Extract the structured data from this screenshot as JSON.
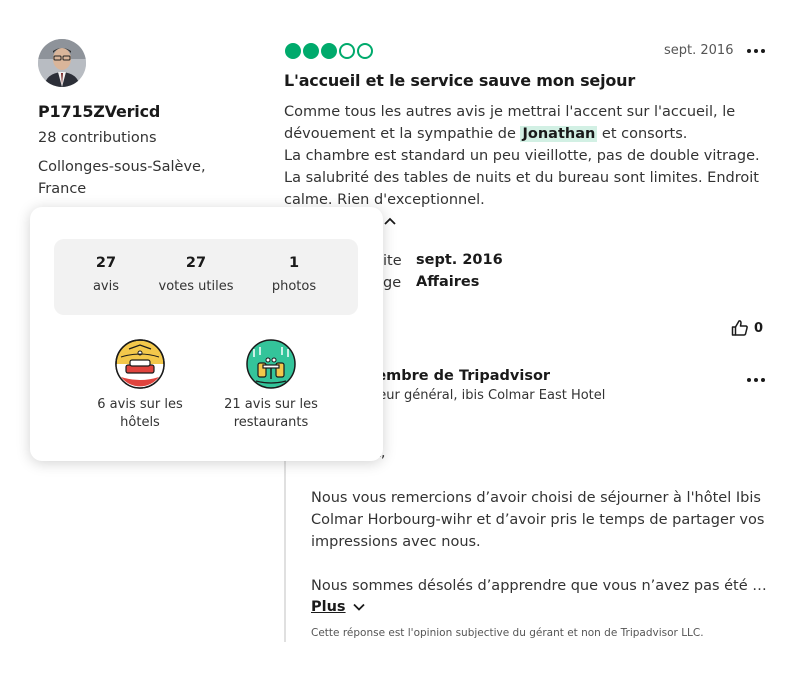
{
  "reviewer": {
    "username": "P1715ZVericd",
    "contributions": "28 contributions",
    "location_line1": "Collonges-sous-Salève,",
    "location_line2": "France"
  },
  "review": {
    "rating": 3,
    "rating_max": 5,
    "date": "sept. 2016",
    "title": "L'accueil et le service sauve mon sejour",
    "text_part1": "Comme tous les autres avis je mettrai l'accent sur l'accueil, le dévouement et la sympathie de ",
    "highlight": "Jonathan",
    "text_part2": " et consorts.",
    "text_line3": "La chambre est standard un peu vieillotte, pas de double vitrage.",
    "text_line4": "La salubrité des tables de nuits et du bureau sont limites. Endroit calme. Rien d'exceptionnel.",
    "meta_label_1_visible": "ite",
    "meta_value_1": "sept. 2016",
    "meta_label_2_visible": "ge",
    "meta_value_2": "Affaires",
    "helpful_count": "0"
  },
  "response": {
    "name_visible": "nembre de Tripadvisor",
    "role_visible": "cteur général, ibis Colmar East Hotel",
    "greeting_visible": "nt,",
    "paragraph1": "Nous vous remercions d’avoir choisi de séjourner à l'hôtel Ibis Colmar Horbourg-wihr et d’avoir pris le temps de partager vos impressions avec nous.",
    "paragraph2": "Nous sommes désolés d’apprendre que vous n’avez pas été …",
    "more_label": "Plus",
    "disclaimer": "Cette réponse est l'opinion subjective du gérant et non de Tripadvisor LLC."
  },
  "popover": {
    "stats": [
      {
        "value": "27",
        "label": "avis"
      },
      {
        "value": "27",
        "label": "votes utiles"
      },
      {
        "value": "1",
        "label": "photos"
      }
    ],
    "badges": [
      {
        "icon": "hotel-badge-icon",
        "line1": "6 avis sur les",
        "line2": "hôtels"
      },
      {
        "icon": "restaurant-badge-icon",
        "line1": "21 avis sur les",
        "line2": "restaurants"
      }
    ]
  },
  "colors": {
    "rating_green": "#00aa6c",
    "highlight_bg": "#d2f0e4"
  }
}
